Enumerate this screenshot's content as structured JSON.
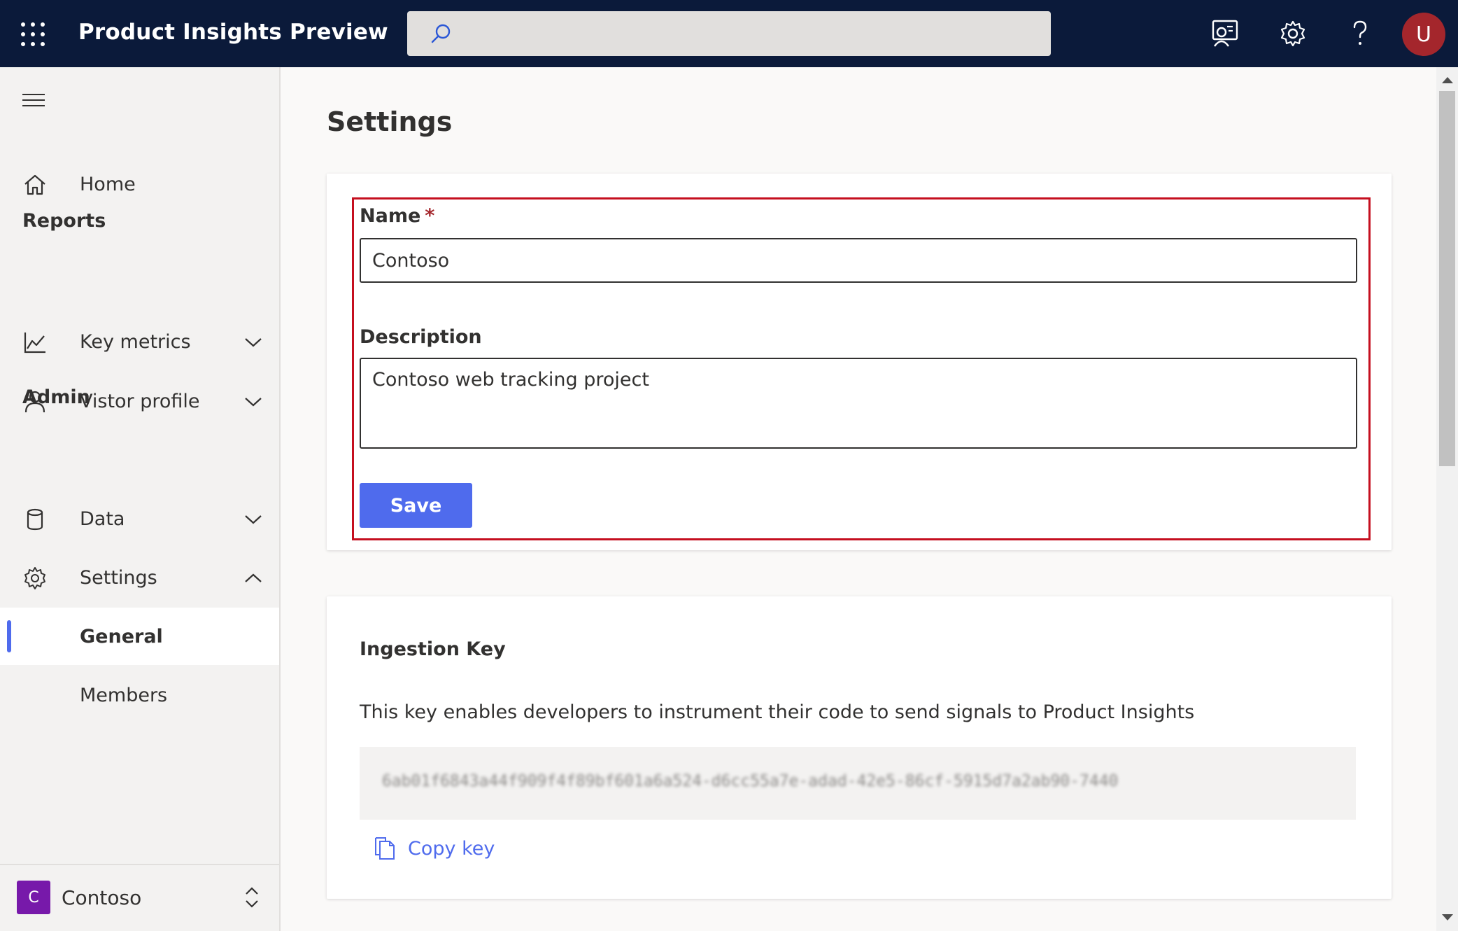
{
  "header": {
    "app_title": "Product Insights Preview",
    "search_placeholder": "",
    "avatar_initial": "U",
    "icons": [
      "waffle-icon",
      "search-icon",
      "feedback-icon",
      "gear-icon",
      "help-icon"
    ]
  },
  "sidebar": {
    "home": "Home",
    "reports_header": "Reports",
    "key_metrics": "Key metrics",
    "visitor_profile": "Vistor profile",
    "admin_header": "Admin",
    "data": "Data",
    "settings": "Settings",
    "general": "General",
    "members": "Members",
    "project_initial": "C",
    "project_name": "Contoso"
  },
  "main": {
    "page_title": "Settings",
    "form": {
      "name_label": "Name",
      "required_mark": "*",
      "name_value": "Contoso",
      "description_label": "Description",
      "description_value": "Contoso web tracking project",
      "save_label": "Save"
    },
    "ingestion": {
      "title": "Ingestion Key",
      "description": "This key enables developers to instrument their code to send signals to Product Insights",
      "key_value": "6ab01f6843a44f909f4f89bf601a6a524-d6cc55a7e-adad-42e5-86cf-5915d7a2ab90-7440",
      "copy_label": "Copy key"
    }
  },
  "colors": {
    "topbar": "#0b1a3a",
    "accent": "#4f6bed",
    "highlight_border": "#c50f1f",
    "avatar": "#a4262c",
    "project_badge": "#7719aa"
  }
}
